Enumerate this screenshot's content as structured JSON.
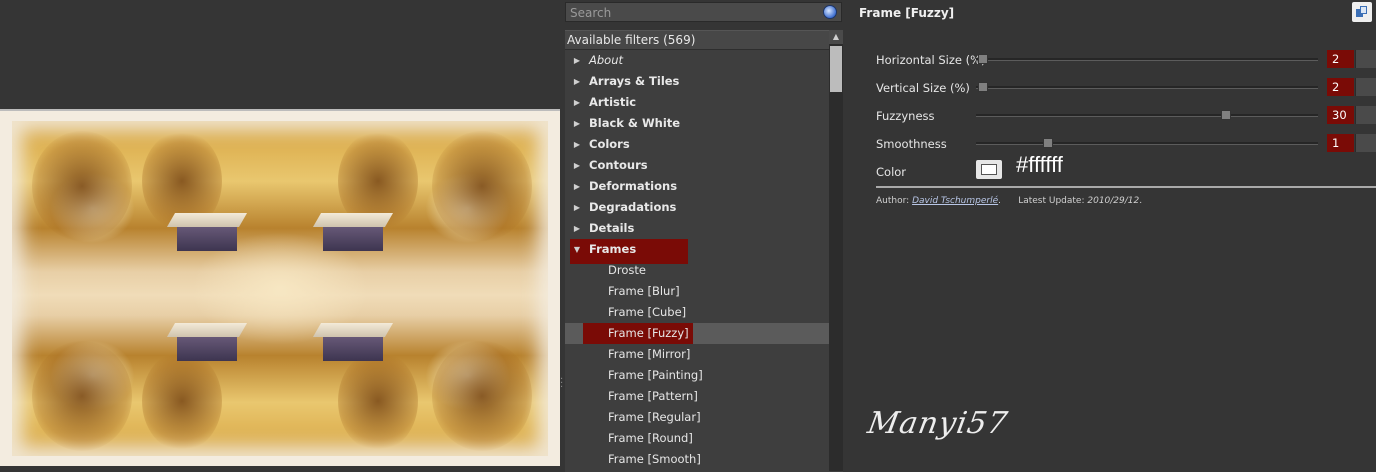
{
  "search": {
    "placeholder": "Search"
  },
  "filters": {
    "header": "Available filters (569)",
    "categories": [
      {
        "label": "About",
        "italic": true
      },
      {
        "label": "Arrays & Tiles"
      },
      {
        "label": "Artistic"
      },
      {
        "label": "Black & White"
      },
      {
        "label": "Colors"
      },
      {
        "label": "Contours"
      },
      {
        "label": "Deformations"
      },
      {
        "label": "Degradations"
      },
      {
        "label": "Details"
      },
      {
        "label": "Frames",
        "expanded": true
      }
    ],
    "frames_children": [
      "Droste",
      "Frame [Blur]",
      "Frame [Cube]",
      "Frame [Fuzzy]",
      "Frame [Mirror]",
      "Frame [Painting]",
      "Frame [Pattern]",
      "Frame [Regular]",
      "Frame [Round]",
      "Frame [Smooth]"
    ],
    "selected": "Frame [Fuzzy]"
  },
  "params": {
    "title": "Frame [Fuzzy]",
    "sliders": [
      {
        "label": "Horizontal Size (%)",
        "value": "2",
        "fraction": 0.02
      },
      {
        "label": "Vertical Size (%)",
        "value": "2",
        "fraction": 0.02
      },
      {
        "label": "Fuzzyness",
        "value": "30",
        "fraction": 0.73
      },
      {
        "label": "Smoothness",
        "value": "1",
        "fraction": 0.21
      }
    ],
    "color": {
      "label": "Color",
      "hex": "#ffffff"
    },
    "author_prefix": "Author:",
    "author_name": "David Tschumperlé",
    "author_suffix": ".",
    "update_prefix": "Latest Update:",
    "update_date": "2010/29/12",
    "update_suffix": "."
  },
  "watermark": "Manyi57",
  "colors": {
    "selection": "#7a0b06",
    "panel": "#353535"
  }
}
